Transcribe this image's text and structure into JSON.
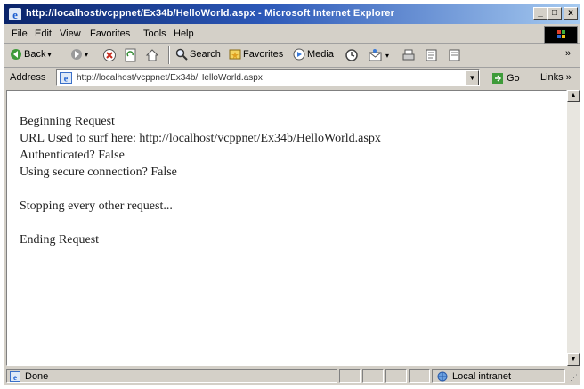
{
  "window": {
    "title": "http://localhost/vcppnet/Ex34b/HelloWorld.aspx - Microsoft Internet Explorer",
    "controls": [
      "_",
      "□",
      "x"
    ]
  },
  "menubar": {
    "items": [
      {
        "label": "File"
      },
      {
        "label": "Edit"
      },
      {
        "label": "View"
      },
      {
        "label": "Favorites"
      },
      {
        "label": "Tools"
      },
      {
        "label": "Help"
      }
    ]
  },
  "toolbar": {
    "back_label": "Back",
    "search_label": "Search",
    "favorites_label": "Favorites",
    "media_label": "Media"
  },
  "addressbar": {
    "label": "Address",
    "url": "http://localhost/vcppnet/Ex34b/HelloWorld.aspx",
    "go_label": "Go",
    "links_label": "Links"
  },
  "content": {
    "lines": [
      "Beginning Request",
      "URL Used to surf here: http://localhost/vcppnet/Ex34b/HelloWorld.aspx",
      "Authenticated? False",
      "Using secure connection? False",
      "",
      "Stopping every other request...",
      "",
      "Ending Request"
    ]
  },
  "statusbar": {
    "status": "Done",
    "zone": "Local intranet"
  },
  "colors": {
    "titlebar_start": "#0a246a",
    "titlebar_end": "#a6caf0",
    "chrome": "#d4d0c8"
  }
}
